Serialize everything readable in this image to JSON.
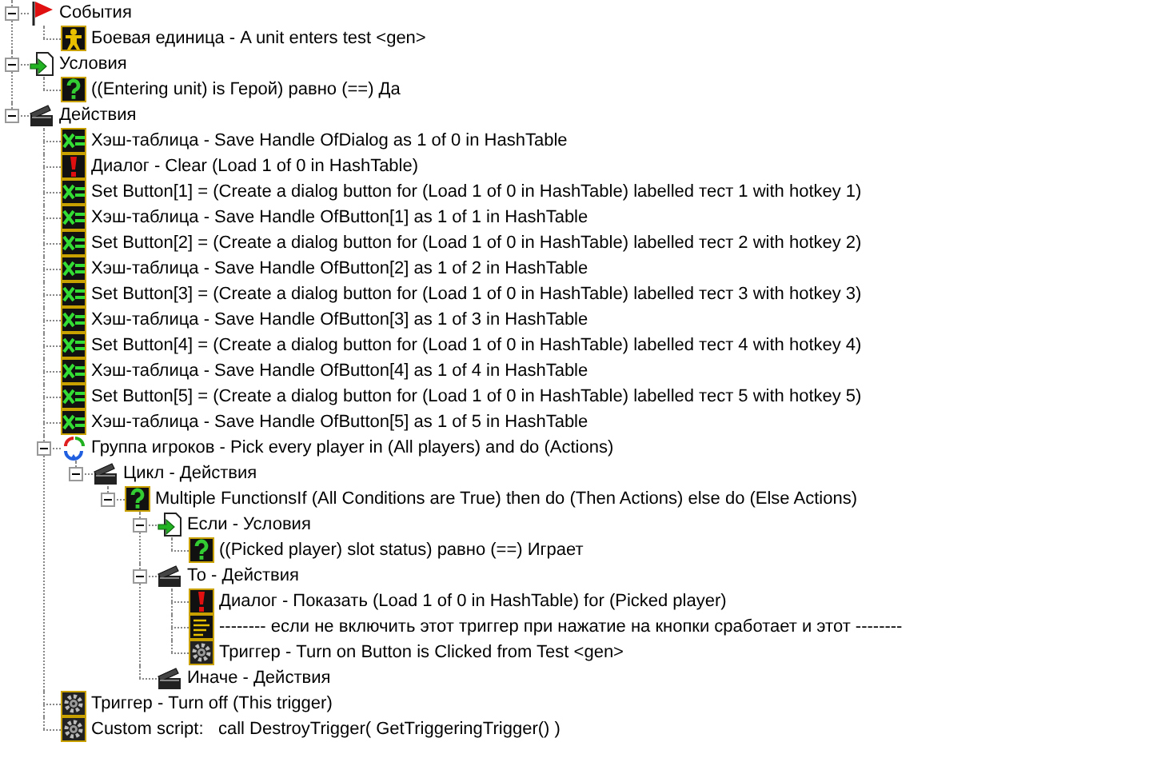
{
  "tree": [
    {
      "label": "События",
      "kind": "event",
      "expanded": true,
      "children": [
        {
          "label": "Боевая единица - A unit enters test <gen>",
          "kind": "unit"
        }
      ]
    },
    {
      "label": "Условия",
      "kind": "conditions",
      "expanded": true,
      "children": [
        {
          "label": "((Entering unit) is Герой) равно (==) Да",
          "kind": "question"
        }
      ]
    },
    {
      "label": "Действия",
      "kind": "actions",
      "expanded": true,
      "children": [
        {
          "label": "Хэш-таблица - Save Handle OfDialog as 1 of 0 in HashTable",
          "kind": "set"
        },
        {
          "label": "Диалог - Clear (Load 1 of 0 in HashTable)",
          "kind": "alert"
        },
        {
          "label": "Set Button[1] = (Create a dialog button for (Load 1 of 0 in HashTable) labelled тест 1 with hotkey 1)",
          "kind": "set"
        },
        {
          "label": "Хэш-таблица - Save Handle OfButton[1] as 1 of 1 in HashTable",
          "kind": "set"
        },
        {
          "label": "Set Button[2] = (Create a dialog button for (Load 1 of 0 in HashTable) labelled тест 2 with hotkey 2)",
          "kind": "set"
        },
        {
          "label": "Хэш-таблица - Save Handle OfButton[2] as 1 of 2 in HashTable",
          "kind": "set"
        },
        {
          "label": "Set Button[3] = (Create a dialog button for (Load 1 of 0 in HashTable) labelled тест 3 with hotkey 3)",
          "kind": "set"
        },
        {
          "label": "Хэш-таблица - Save Handle OfButton[3] as 1 of 3 in HashTable",
          "kind": "set"
        },
        {
          "label": "Set Button[4] = (Create a dialog button for (Load 1 of 0 in HashTable) labelled тест 4 with hotkey 4)",
          "kind": "set"
        },
        {
          "label": "Хэш-таблица - Save Handle OfButton[4] as 1 of 4 in HashTable",
          "kind": "set"
        },
        {
          "label": "Set Button[5] = (Create a dialog button for (Load 1 of 0 in HashTable) labelled тест 5 with hotkey 5)",
          "kind": "set"
        },
        {
          "label": "Хэш-таблица - Save Handle OfButton[5] as 1 of 5 in HashTable",
          "kind": "set"
        },
        {
          "label": "Группа игроков - Pick every player in (All players) and do (Actions)",
          "kind": "group",
          "expanded": true,
          "children": [
            {
              "label": "Цикл - Действия",
              "kind": "actions",
              "expanded": true,
              "children": [
                {
                  "label": "Multiple FunctionsIf (All Conditions are True) then do (Then Actions) else do (Else Actions)",
                  "kind": "question",
                  "expanded": true,
                  "children": [
                    {
                      "label": "Если - Условия",
                      "kind": "conditions",
                      "expanded": true,
                      "children": [
                        {
                          "label": "((Picked player) slot status) равно (==) Играет",
                          "kind": "question"
                        }
                      ]
                    },
                    {
                      "label": "То - Действия",
                      "kind": "actions",
                      "expanded": true,
                      "children": [
                        {
                          "label": "Диалог - Показать (Load 1 of 0 in HashTable) for (Picked player)",
                          "kind": "alert"
                        },
                        {
                          "label": "-------- если не включить этот триггер при нажатие на кнопки сработает и этот --------",
                          "kind": "comment"
                        },
                        {
                          "label": "Триггер - Turn on Button is Clicked from Test <gen>",
                          "kind": "gear"
                        }
                      ]
                    },
                    {
                      "label": "Иначе - Действия",
                      "kind": "actions"
                    }
                  ]
                }
              ]
            }
          ]
        },
        {
          "label": "Триггер - Turn off (This trigger)",
          "kind": "gear"
        },
        {
          "label": "Custom script:   call DestroyTrigger( GetTriggeringTrigger() )",
          "kind": "gear"
        }
      ]
    }
  ]
}
